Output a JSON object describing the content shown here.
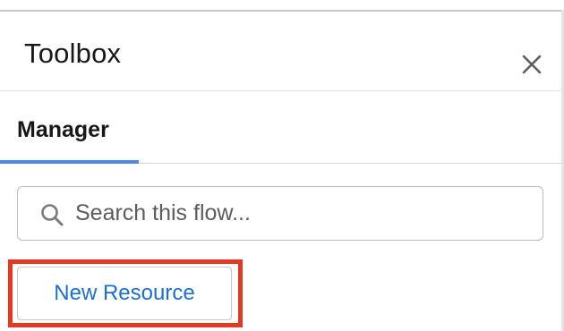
{
  "panel": {
    "title": "Toolbox"
  },
  "icons": {
    "close": "close-icon",
    "search": "search-icon"
  },
  "tabs": [
    {
      "label": "Manager",
      "active": true
    }
  ],
  "search": {
    "placeholder": "Search this flow...",
    "value": ""
  },
  "actions": {
    "new_resource_label": "New Resource"
  },
  "colors": {
    "accent_tab": "#4f86e8",
    "link_blue": "#1b6ed4",
    "highlight": "#e23a22"
  }
}
